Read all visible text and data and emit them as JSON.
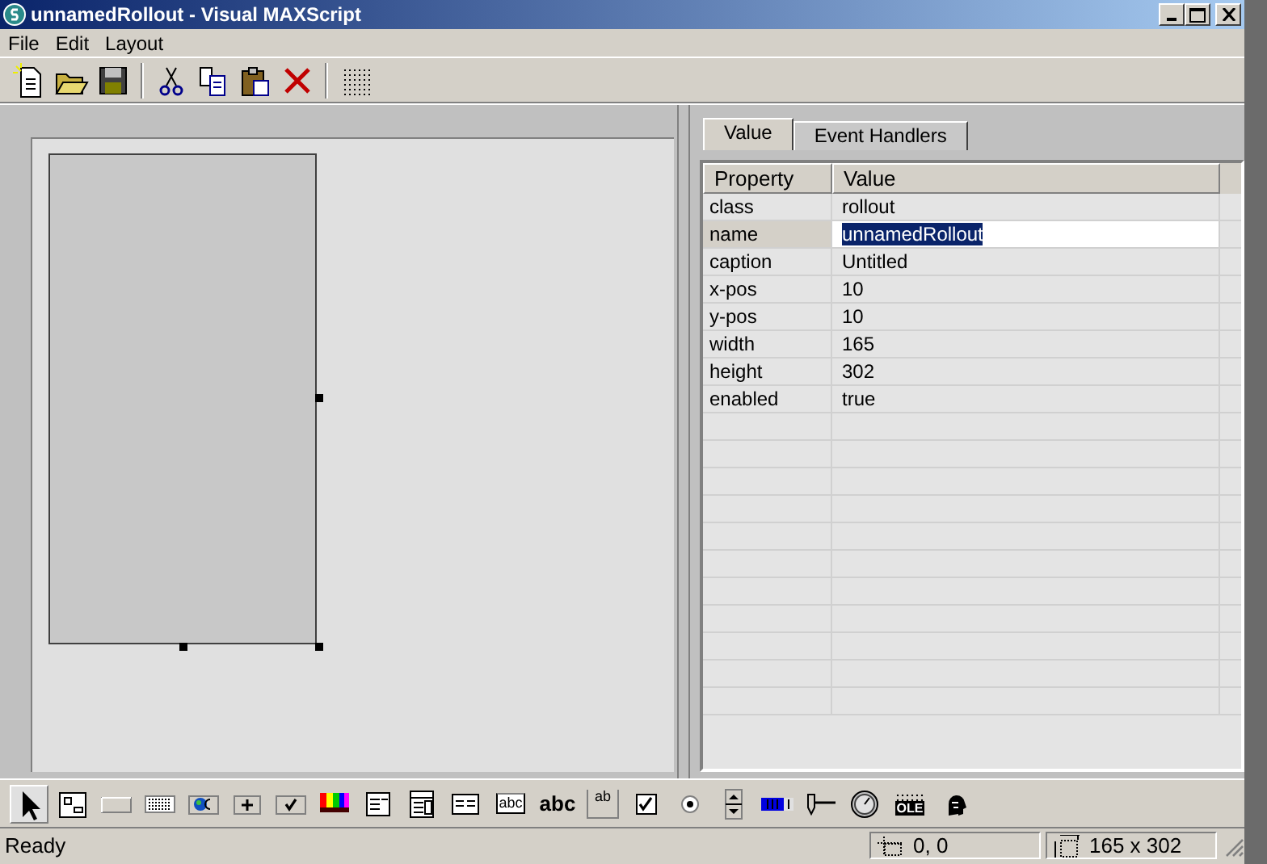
{
  "window": {
    "title": "unnamedRollout - Visual MAXScript"
  },
  "menu": [
    "File",
    "Edit",
    "Layout"
  ],
  "toolbar": [
    {
      "kind": "new"
    },
    {
      "kind": "open"
    },
    {
      "kind": "save"
    },
    {
      "kind": "sep"
    },
    {
      "kind": "cut"
    },
    {
      "kind": "copy"
    },
    {
      "kind": "paste"
    },
    {
      "kind": "delete"
    },
    {
      "kind": "sep"
    },
    {
      "kind": "grid"
    }
  ],
  "tabs": [
    {
      "label": "Value",
      "selected": true
    },
    {
      "label": "Event Handlers",
      "selected": false
    }
  ],
  "grid": {
    "columns": [
      "Property",
      "Value"
    ],
    "rows": [
      {
        "property": "class",
        "value": "rollout",
        "selected": false
      },
      {
        "property": "name",
        "value": "unnamedRollout",
        "selected": true
      },
      {
        "property": "caption",
        "value": "Untitled",
        "selected": false
      },
      {
        "property": "x-pos",
        "value": "10",
        "selected": false
      },
      {
        "property": "y-pos",
        "value": "10",
        "selected": false
      },
      {
        "property": "width",
        "value": "165",
        "selected": false
      },
      {
        "property": "height",
        "value": "302",
        "selected": false
      },
      {
        "property": "enabled",
        "value": "true",
        "selected": false
      }
    ]
  },
  "tools": [
    {
      "kind": "pointer",
      "selected": true
    },
    {
      "kind": "bitmap",
      "selected": false
    },
    {
      "kind": "button",
      "selected": false
    },
    {
      "kind": "mapbutton",
      "selected": false
    },
    {
      "kind": "materialbutton",
      "selected": false
    },
    {
      "kind": "pickbutton",
      "selected": false
    },
    {
      "kind": "checkbutton",
      "selected": false
    },
    {
      "kind": "colorpicker",
      "selected": false
    },
    {
      "kind": "combobox",
      "selected": false
    },
    {
      "kind": "dropdown",
      "selected": false
    },
    {
      "kind": "listbox",
      "selected": false
    },
    {
      "kind": "edittext",
      "text": "abc",
      "selected": false
    },
    {
      "kind": "label",
      "text": "abc",
      "selected": false
    },
    {
      "kind": "groupbox",
      "text": "ab",
      "selected": false
    },
    {
      "kind": "checkbox",
      "selected": false
    },
    {
      "kind": "radio",
      "selected": false
    },
    {
      "kind": "spinner",
      "selected": false
    },
    {
      "kind": "progressbar",
      "selected": false
    },
    {
      "kind": "slider",
      "selected": false
    },
    {
      "kind": "timer",
      "selected": false
    },
    {
      "kind": "activex",
      "text": "OLE",
      "selected": false
    },
    {
      "kind": "hyperlink",
      "selected": false
    }
  ],
  "status_bar": {
    "message": "Ready",
    "position": "0, 0",
    "size": "165 x 302"
  }
}
